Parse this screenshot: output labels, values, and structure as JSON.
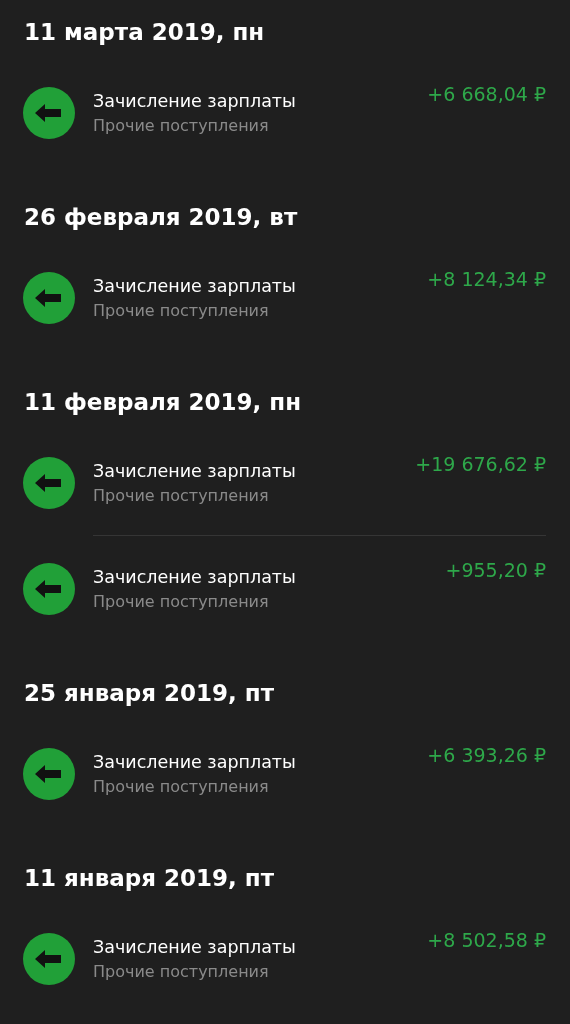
{
  "sections": [
    {
      "date": "11 марта 2019, пн",
      "transactions": [
        {
          "title": "Зачисление зарплаты",
          "category": "Прочие поступления",
          "amount": "+6 668,04 ₽"
        }
      ]
    },
    {
      "date": "26 февраля 2019, вт",
      "transactions": [
        {
          "title": "Зачисление зарплаты",
          "category": "Прочие поступления",
          "amount": "+8 124,34 ₽"
        }
      ]
    },
    {
      "date": "11 февраля 2019, пн",
      "transactions": [
        {
          "title": "Зачисление зарплаты",
          "category": "Прочие поступления",
          "amount": "+19 676,62 ₽"
        },
        {
          "title": "Зачисление зарплаты",
          "category": "Прочие поступления",
          "amount": "+955,20 ₽"
        }
      ]
    },
    {
      "date": "25 января 2019, пт",
      "transactions": [
        {
          "title": "Зачисление зарплаты",
          "category": "Прочие поступления",
          "amount": "+6 393,26 ₽"
        }
      ]
    },
    {
      "date": "11 января 2019, пт",
      "transactions": [
        {
          "title": "Зачисление зарплаты",
          "category": "Прочие поступления",
          "amount": "+8 502,58 ₽"
        }
      ]
    }
  ]
}
